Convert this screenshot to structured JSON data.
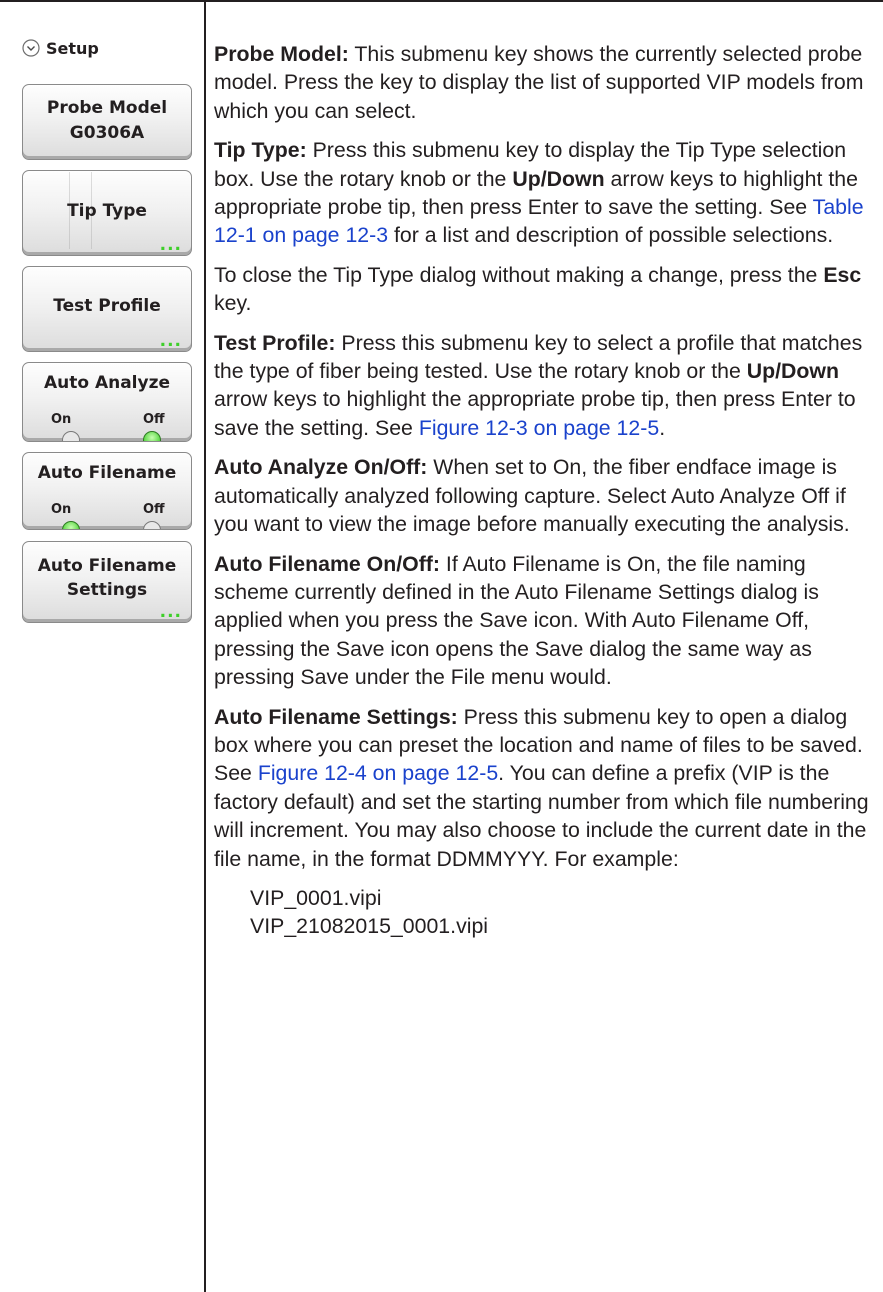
{
  "menu": {
    "title": "Setup",
    "keys": {
      "probe_model": {
        "line1": "Probe Model",
        "line2": "G0306A"
      },
      "tip_type": {
        "label": "Tip Type",
        "more": "..."
      },
      "test_profile": {
        "label": "Test Profile",
        "more": "..."
      },
      "auto_analyze": {
        "label": "Auto Analyze",
        "on": "On",
        "off": "Off",
        "state": "Off"
      },
      "auto_filename": {
        "label": "Auto Filename",
        "on": "On",
        "off": "Off",
        "state": "On"
      },
      "auto_filename_settings": {
        "line1": "Auto Filename",
        "line2": "Settings",
        "more": "..."
      }
    }
  },
  "content": {
    "probe_model": {
      "heading": "Probe Model:",
      "text": " This submenu key shows the currently selected probe model. Press the key to display the list of supported VIP models from which you can select."
    },
    "tip_type": {
      "heading": "Tip Type:",
      "t1": " Press this submenu key to display the Tip Type selection box. Use the rotary knob or the ",
      "b1": "Up/Down",
      "t2": " arrow keys to highlight the appropriate probe tip, then press Enter to save the setting. See ",
      "link": "Table 12-1 on page 12-3",
      "t3": " for a list and description of possible selections."
    },
    "tip_close": {
      "t1": "To close the Tip Type dialog without making a change, press the ",
      "b1": "Esc",
      "t2": " key."
    },
    "test_profile": {
      "heading": "Test Profile:",
      "t1": " Press this submenu key to select a profile that matches the type of fiber being tested. Use the rotary knob or the ",
      "b1": "Up/Down",
      "t2": " arrow keys to highlight the appropriate probe tip, then press Enter to save the setting. See ",
      "link": "Figure 12-3 on page 12-5",
      "t3": "."
    },
    "auto_analyze": {
      "heading": "Auto Analyze On/Off:",
      "text": " When set to On, the fiber endface image is automatically analyzed following capture. Select Auto Analyze Off if you want to view the image before manually executing the analysis."
    },
    "auto_filename": {
      "heading": "Auto Filename On/Off:",
      "text": " If Auto Filename is On, the file naming scheme currently defined in the Auto Filename Settings dialog is applied when you press the Save icon. With Auto Filename Off, pressing the Save icon opens the Save dialog the same way as pressing Save under the File menu would."
    },
    "auto_filename_settings": {
      "heading": "Auto Filename Settings:",
      "t1": " Press this submenu key to open a dialog box where you can preset the location and name of files to be saved. See ",
      "link": "Figure 12-4 on page 12-5",
      "t2": ". You can define a prefix (VIP is the factory default) and set the starting number from which file numbering will increment. You may also choose to include the current date in the file name, in the format DDMMYYY. For example:"
    },
    "examples": [
      "VIP_0001.vipi",
      "VIP_21082015_0001.vipi"
    ]
  },
  "colors": {
    "link": "#1a42cc",
    "indicator_green": "#3ecf2a",
    "text": "#231f20"
  }
}
